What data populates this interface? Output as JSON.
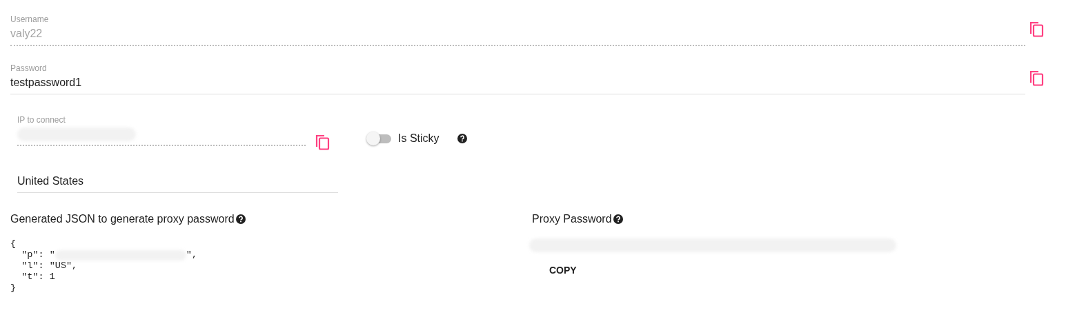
{
  "fields": [
    {
      "label": "Username",
      "value": "valy22",
      "disabled": true,
      "copy": true
    },
    {
      "label": "Password",
      "value": "testpassword1",
      "disabled": false,
      "copy": true
    }
  ],
  "ip_field": {
    "label": "IP to connect",
    "disabled": true,
    "redacted": true,
    "copy": true
  },
  "sticky_toggle": {
    "label": "Is Sticky",
    "on": false,
    "help": true
  },
  "country_select": {
    "value": "United States"
  },
  "json_panel": {
    "heading": "Generated JSON to generate proxy password",
    "help": true,
    "lines": [
      {
        "text": "{",
        "redacted": false
      },
      {
        "text": "  \"p\": \"",
        "redacted": true,
        "tail": "\","
      },
      {
        "text": "  \"l\": \"US\",",
        "redacted": false
      },
      {
        "text": "  \"t\": 1",
        "redacted": false
      },
      {
        "text": "}",
        "redacted": false
      }
    ]
  },
  "proxy_panel": {
    "heading": "Proxy Password",
    "help": true,
    "redacted": true,
    "button": "COPY"
  }
}
